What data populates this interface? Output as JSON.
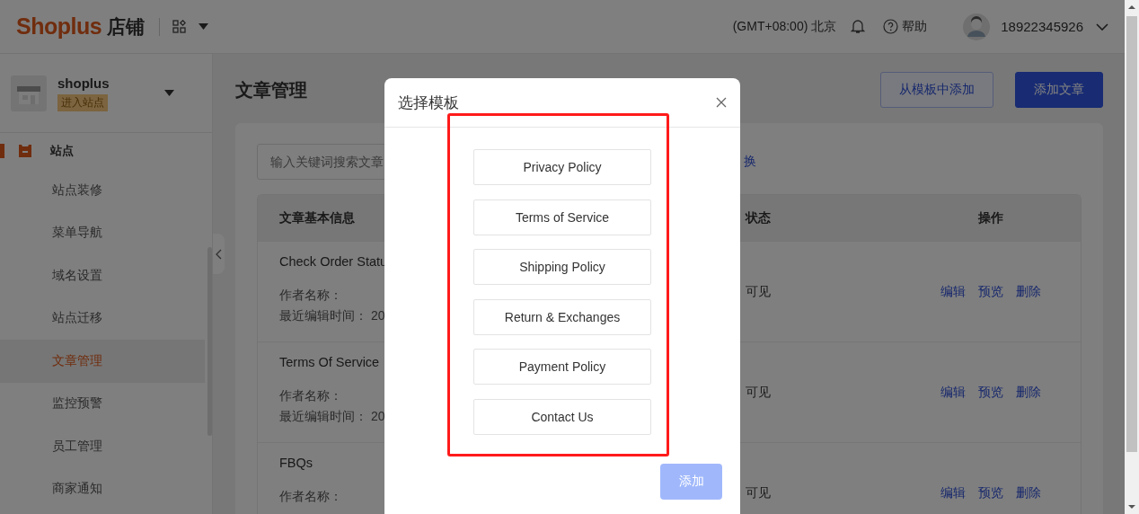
{
  "topbar": {
    "logo": "Shoplus",
    "logo_suffix": "店铺",
    "timezone": "(GMT+08:00) 北京",
    "help": "帮助",
    "user": "18922345926"
  },
  "sidebar": {
    "store_name": "shoplus",
    "store_badge": "进入站点",
    "group": "站点",
    "items": [
      {
        "label": "站点装修",
        "selected": false
      },
      {
        "label": "菜单导航",
        "selected": false
      },
      {
        "label": "域名设置",
        "selected": false
      },
      {
        "label": "站点迁移",
        "selected": false
      },
      {
        "label": "文章管理",
        "selected": true
      },
      {
        "label": "监控预警",
        "selected": false
      },
      {
        "label": "员工管理",
        "selected": false
      },
      {
        "label": "商家通知",
        "selected": false
      }
    ]
  },
  "page": {
    "title": "文章管理",
    "buttons": [
      {
        "label": "从模板中添加",
        "kind": "outline"
      },
      {
        "label": "添加文章",
        "kind": "primary"
      }
    ],
    "search": {
      "placeholder": "输入关键词搜索文章"
    },
    "link_fragment": "换",
    "table": {
      "columns": [
        "文章基本信息",
        "状态",
        "操作"
      ],
      "rows": [
        {
          "title": "Check Order Statu",
          "author_label": "作者名称：",
          "time_label": "最近编辑时间： 20",
          "status": "可见",
          "actions": [
            "编辑",
            "预览",
            "删除"
          ]
        },
        {
          "title": "Terms Of Service",
          "author_label": "作者名称：",
          "time_label": "最近编辑时间： 20",
          "status": "可见",
          "actions": [
            "编辑",
            "预览",
            "删除"
          ]
        },
        {
          "title": "FBQs",
          "author_label": "作者名称：",
          "status": "可见",
          "actions": [
            "编辑",
            "预览",
            "删除"
          ]
        }
      ]
    }
  },
  "modal": {
    "title": "选择模板",
    "templates": [
      "Privacy Policy",
      "Terms of Service",
      "Shipping Policy",
      "Return & Exchanges",
      "Payment Policy",
      "Contact Us"
    ],
    "add_button": {
      "label": "添加",
      "disabled": true
    }
  }
}
